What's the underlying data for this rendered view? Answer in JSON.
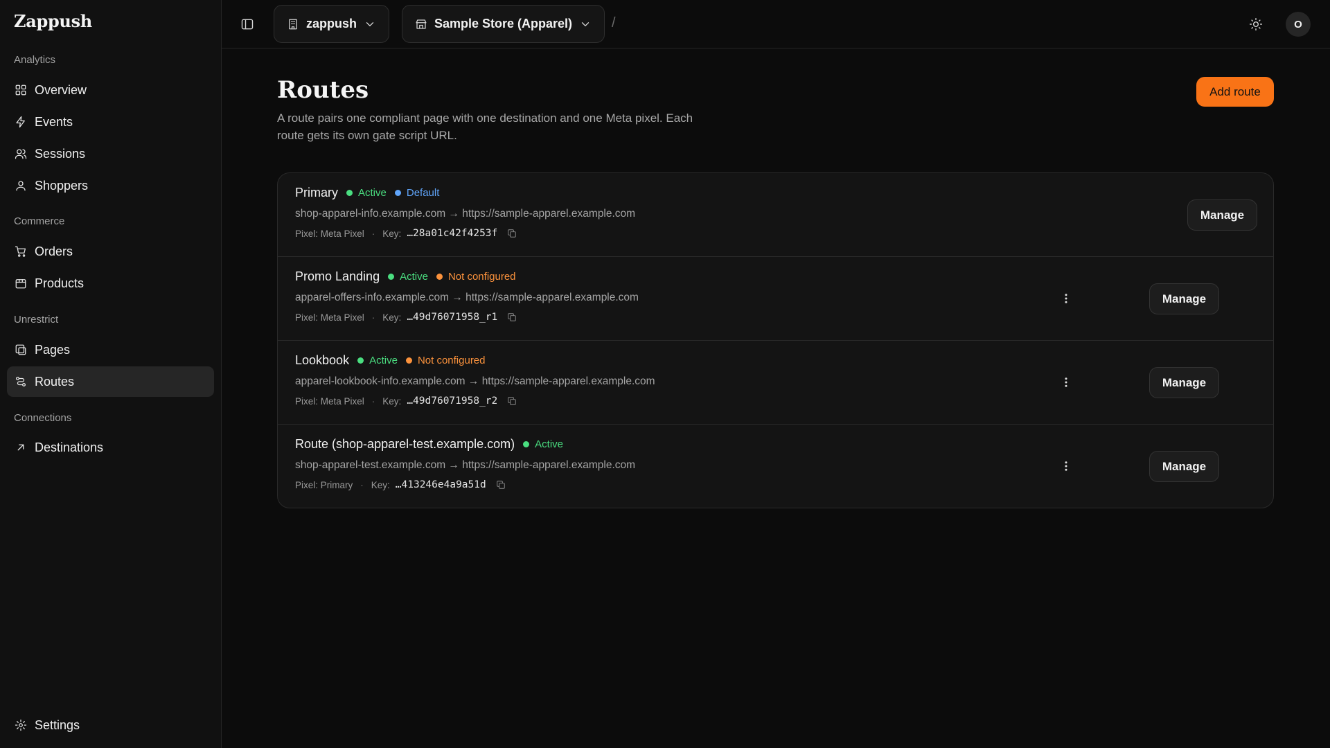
{
  "app": {
    "brand": "Zappush"
  },
  "sidebar": {
    "sections": [
      {
        "label": "Analytics"
      },
      {
        "label": "Commerce"
      },
      {
        "label": "Unrestrict"
      },
      {
        "label": "Connections"
      }
    ],
    "items": [
      {
        "label": "Overview",
        "icon": "grid-icon"
      },
      {
        "label": "Events",
        "icon": "bolt-icon"
      },
      {
        "label": "Sessions",
        "icon": "users-icon"
      },
      {
        "label": "Shoppers",
        "icon": "user-icon"
      },
      {
        "label": "Orders",
        "icon": "cart-icon"
      },
      {
        "label": "Products",
        "icon": "package-icon"
      },
      {
        "label": "Pages",
        "icon": "pages-icon"
      },
      {
        "label": "Routes",
        "icon": "routes-icon",
        "active": true
      },
      {
        "label": "Destinations",
        "icon": "arrow-up-right-icon"
      }
    ],
    "settings_label": "Settings"
  },
  "topbar": {
    "org": "zappush",
    "separator": "/",
    "store": "Sample Store (Apparel)",
    "avatar_initial": "O"
  },
  "page": {
    "title": "Routes",
    "description": "A route pairs one compliant page with one destination and one Meta pixel. Each route gets its own gate script URL.",
    "add_button": "Add route"
  },
  "status_colors": {
    "active": "#4ade80",
    "default": "#60a5fa",
    "not_configured": "#fb923c",
    "accent": "#f97316"
  },
  "routes": [
    {
      "name": "Primary",
      "status": "Active",
      "extra_badge": "Default",
      "extra_badge_type": "default",
      "source": "shop-apparel-info.example.com",
      "arrow": "→",
      "destination": "https://sample-apparel.example.com",
      "pixel": "Pixel: Meta Pixel",
      "key_label": "Key:",
      "key": "…28a01c42f4253f",
      "manage": "Manage",
      "has_menu": false
    },
    {
      "name": "Promo Landing",
      "status": "Active",
      "extra_badge": "Not configured",
      "extra_badge_type": "not_configured",
      "source": "apparel-offers-info.example.com",
      "arrow": "→",
      "destination": "https://sample-apparel.example.com",
      "pixel": "Pixel: Meta Pixel",
      "key_label": "Key:",
      "key": "…49d76071958_r1",
      "manage": "Manage",
      "has_menu": true
    },
    {
      "name": "Lookbook",
      "status": "Active",
      "extra_badge": "Not configured",
      "extra_badge_type": "not_configured",
      "source": "apparel-lookbook-info.example.com",
      "arrow": "→",
      "destination": "https://sample-apparel.example.com",
      "pixel": "Pixel: Meta Pixel",
      "key_label": "Key:",
      "key": "…49d76071958_r2",
      "manage": "Manage",
      "has_menu": true
    },
    {
      "name": "Route (shop-apparel-test.example.com)",
      "status": "Active",
      "extra_badge": null,
      "extra_badge_type": null,
      "source": "shop-apparel-test.example.com",
      "arrow": "→",
      "destination": "https://sample-apparel.example.com",
      "pixel": "Pixel: Primary",
      "key_label": "Key:",
      "key": "…413246e4a9a51d",
      "manage": "Manage",
      "has_menu": true
    }
  ]
}
